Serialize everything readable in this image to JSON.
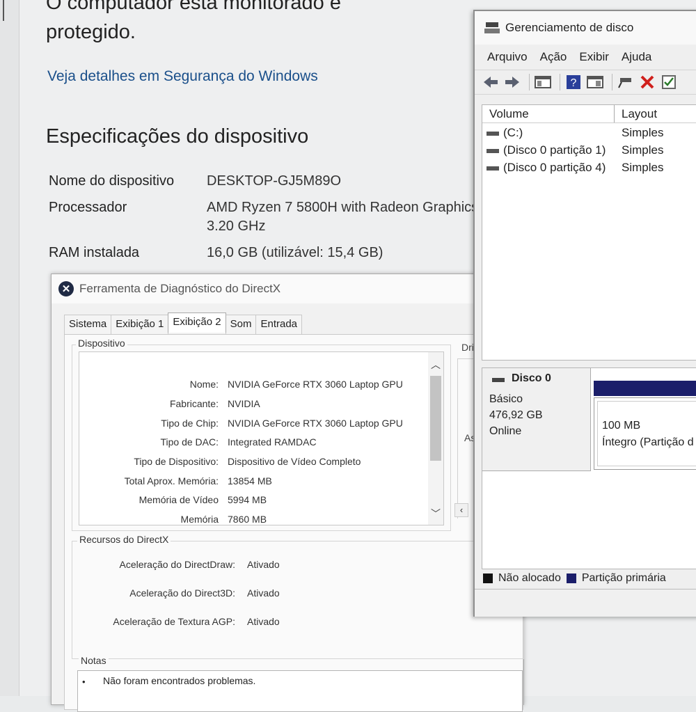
{
  "settings": {
    "heading_line1": "O computador está monitorado e",
    "heading_line2": "protegido.",
    "security_link": "Veja detalhes em Segurança do Windows",
    "specs_title": "Especificações do dispositivo",
    "specs": [
      {
        "label": "Nome do dispositivo",
        "value": "DESKTOP-GJ5M89O"
      },
      {
        "label": "Processador",
        "value": "AMD Ryzen 7 5800H with Radeon Graphics",
        "value2": "3.20 GHz"
      },
      {
        "label": "RAM instalada",
        "value": "16,0 GB (utilizável: 15,4 GB)"
      }
    ]
  },
  "dxdiag": {
    "title": "Ferramenta de Diagnóstico do DirectX",
    "title_icon": "directx-x-icon",
    "tabs": [
      "Sistema",
      "Exibição 1",
      "Exibição 2",
      "Som",
      "Entrada"
    ],
    "active_tab": "Exibição 2",
    "device_group": "Dispositivo",
    "drivers_group_partial": "Dri",
    "drivers_partial_text": "As",
    "device_rows": [
      {
        "key": "Nome:",
        "value": "NVIDIA GeForce RTX 3060 Laptop GPU"
      },
      {
        "key": "Fabricante:",
        "value": "NVIDIA"
      },
      {
        "key": "Tipo de Chip:",
        "value": "NVIDIA GeForce RTX 3060 Laptop GPU"
      },
      {
        "key": "Tipo de DAC:",
        "value": "Integrated RAMDAC"
      },
      {
        "key": "Tipo de Dispositivo:",
        "value": "Dispositivo de Vídeo Completo"
      },
      {
        "key": "Total Aprox. Memória:",
        "value": "13854 MB"
      },
      {
        "key": "Memória de Vídeo",
        "value": "5994 MB"
      },
      {
        "key": "Memória",
        "value": "7860 MB"
      }
    ],
    "resources_group": "Recursos do DirectX",
    "resources": [
      {
        "key": "Aceleração do DirectDraw:",
        "value": "Ativado"
      },
      {
        "key": "Aceleração do Direct3D:",
        "value": "Ativado"
      },
      {
        "key": "Aceleração de Textura AGP:",
        "value": "Ativado"
      }
    ],
    "notes_group": "Notas",
    "notes_bullet": "•",
    "notes": "Não foram encontrados problemas."
  },
  "diskmgmt": {
    "title": "Gerenciamento de disco",
    "menu": [
      "Arquivo",
      "Ação",
      "Exibir",
      "Ajuda"
    ],
    "toolbar_icons": [
      "back-arrow-icon",
      "forward-arrow-icon",
      "console-tree-icon",
      "help-icon",
      "properties-icon",
      "connect-icon",
      "delete-icon",
      "check-icon"
    ],
    "columns": [
      "Volume",
      "Layout"
    ],
    "volumes": [
      {
        "name": "(C:)",
        "layout": "Simples"
      },
      {
        "name": "(Disco 0 partição 1)",
        "layout": "Simples"
      },
      {
        "name": "(Disco 0 partição 4)",
        "layout": "Simples"
      }
    ],
    "disk": {
      "name": "Disco 0",
      "type": "Básico",
      "size": "476,92 GB",
      "status": "Online"
    },
    "partition": {
      "size": "100 MB",
      "status": "Íntegro (Partição d"
    },
    "legend": [
      {
        "label": "Não alocado",
        "color": "#111111"
      },
      {
        "label": "Partição primária",
        "color": "#1b1e6a"
      }
    ]
  }
}
